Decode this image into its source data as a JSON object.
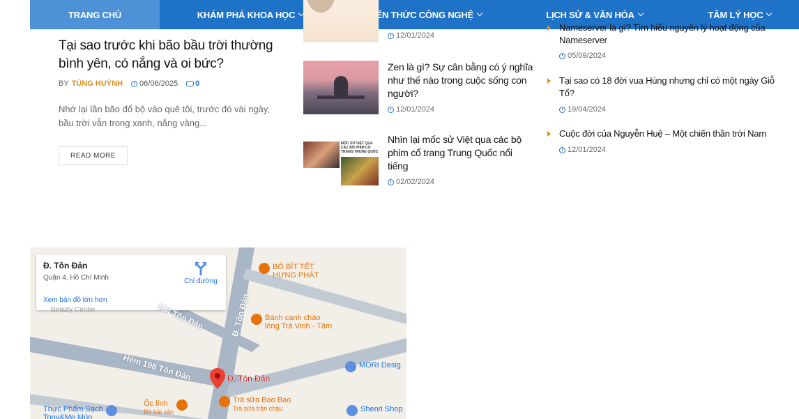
{
  "nav": {
    "items": [
      {
        "label": "TRANG CHỦ",
        "active": true,
        "dropdown": false
      },
      {
        "label": "KHÁM PHÁ KHOA HỌC",
        "dropdown": true
      },
      {
        "label": "KIẾN THỨC CÔNG NGHỆ",
        "dropdown": true
      },
      {
        "label": "LỊCH SỬ & VĂN HÓA",
        "dropdown": true
      },
      {
        "label": "TÂM LÝ HỌC",
        "dropdown": true
      }
    ],
    "bg_color": "#1e73c8"
  },
  "main_article": {
    "title": "Tại sao trước khi bão bầu trời thường bình yên, có nắng và oi bức?",
    "by": "BY",
    "author": "TÙNG HUỲNH",
    "date": "06/06/2025",
    "comments": "0",
    "excerpt": "Nhớ lại lần bão đổ bộ vào quê tôi, trước đó vài ngày, bầu trời vẫn trong xanh, nắng vàng...",
    "read_more": "READ MORE"
  },
  "middle_posts": {
    "top_date": "12/01/2024",
    "items": [
      {
        "title": "Zen là gì? Sự cân bằng có ý nghĩa như thế nào trong cuộc sống con người?",
        "date": "12/01/2024",
        "thumb_icon": "zen-meditation-image"
      },
      {
        "title": "Nhìn lại mốc sử Việt qua các bộ phim cổ trang Trung Quốc nổi tiếng",
        "date": "02/02/2024",
        "thumb_icon": "historical-films-collage-image",
        "thumb_text": "MỐC SỬ VIỆT QUA CÁC BỘ PHIM CỔ TRANG TRUNG QUỐC"
      }
    ]
  },
  "right_list": {
    "items": [
      {
        "title": "Nameserver là gì? Tìm hiểu nguyên lý hoạt động của Nameserver",
        "date": "05/09/2024"
      },
      {
        "title": "Tại sao có 18 đời vua Hùng nhưng chỉ có một ngày Giỗ Tổ?",
        "date": "19/04/2024"
      },
      {
        "title": "Cuộc đời của Nguyễn Huệ – Một chiến thần trời Nam",
        "date": "12/01/2024"
      }
    ],
    "bullet_color": "#e08b1a"
  },
  "map": {
    "card": {
      "title": "Đ. Tôn Đản",
      "subtitle": "Quận 4, Hồ Chí Minh",
      "directions": "Chỉ đường",
      "larger_map": "Xem bản đồ lớn hơn"
    },
    "streets": {
      "s1": "184 Tôn Đản",
      "s2": "Đ. Tôn Đản",
      "s3": "Hẻm 198 Tôn Đản"
    },
    "pois": {
      "p1": "BÒ BÍT TẾT\nHƯNG PHÁT",
      "p2a": "Bánh canh cháo",
      "p2b": "lòng Trà Vinh - Tám",
      "p3": "MORI Desig",
      "p4a": "Trà sữa Bao Bao",
      "p4b": "Trà sữa trân châu",
      "p5a": "Ốc lính",
      "p5b": "Đồ hải sản",
      "p6a": "Thực Phẩm Sạch",
      "p6b": "Tony&Me Mún",
      "p7": "Shenri Shop",
      "p8": "Beauty Center"
    },
    "marker_label": "Đ. Tôn Đản"
  }
}
